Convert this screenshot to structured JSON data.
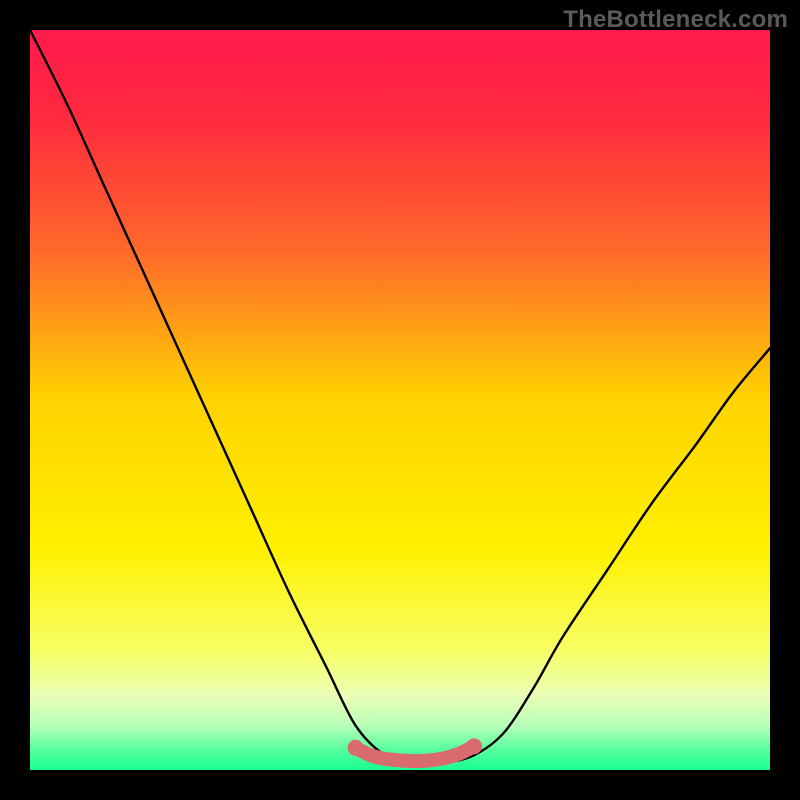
{
  "watermark": {
    "text": "TheBottleneck.com"
  },
  "colors": {
    "frame_bg": "#000000",
    "gradient_stops": [
      {
        "offset": 0.0,
        "color": "#ff1a4d"
      },
      {
        "offset": 0.12,
        "color": "#ff2a3e"
      },
      {
        "offset": 0.3,
        "color": "#ff6a2a"
      },
      {
        "offset": 0.5,
        "color": "#ffd300"
      },
      {
        "offset": 0.7,
        "color": "#fff000"
      },
      {
        "offset": 0.84,
        "color": "#f7ff66"
      },
      {
        "offset": 0.9,
        "color": "#eaffb8"
      },
      {
        "offset": 0.94,
        "color": "#b8ffb8"
      },
      {
        "offset": 0.97,
        "color": "#5effa0"
      },
      {
        "offset": 1.0,
        "color": "#17ff92"
      }
    ],
    "curve": "#000000",
    "trough_marker": "#d96a6e"
  },
  "chart_data": {
    "type": "line",
    "title": "",
    "xlabel": "",
    "ylabel": "",
    "xlim": [
      0,
      1
    ],
    "ylim": [
      0,
      1
    ],
    "series": [
      {
        "name": "bottleneck-curve",
        "x": [
          0.0,
          0.05,
          0.1,
          0.15,
          0.2,
          0.25,
          0.3,
          0.35,
          0.4,
          0.44,
          0.48,
          0.52,
          0.56,
          0.6,
          0.64,
          0.68,
          0.72,
          0.78,
          0.84,
          0.9,
          0.95,
          1.0
        ],
        "values": [
          1.0,
          0.9,
          0.79,
          0.68,
          0.57,
          0.46,
          0.35,
          0.24,
          0.14,
          0.06,
          0.02,
          0.01,
          0.01,
          0.02,
          0.05,
          0.11,
          0.18,
          0.27,
          0.36,
          0.44,
          0.51,
          0.57
        ]
      },
      {
        "name": "trough-marker",
        "x": [
          0.44,
          0.46,
          0.48,
          0.5,
          0.52,
          0.54,
          0.56,
          0.58,
          0.6
        ],
        "values": [
          0.03,
          0.02,
          0.015,
          0.013,
          0.012,
          0.013,
          0.016,
          0.022,
          0.032
        ]
      }
    ]
  }
}
